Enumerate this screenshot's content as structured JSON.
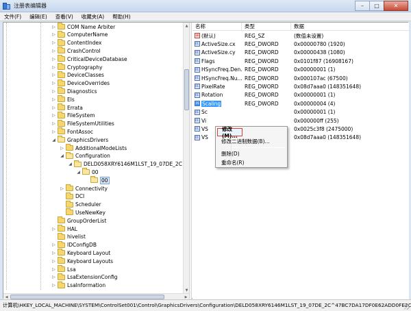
{
  "window": {
    "title": "注册表编辑器",
    "minimize": "–",
    "maximize": "□",
    "close": "✕"
  },
  "menu": [
    "文件(F)",
    "编辑(E)",
    "查看(V)",
    "收藏夹(A)",
    "帮助(H)"
  ],
  "tree": {
    "items": [
      {
        "label": "COM Name Arbiter",
        "toggle": "▷"
      },
      {
        "label": "ComputerName",
        "toggle": "▷"
      },
      {
        "label": "ContentIndex",
        "toggle": "▷"
      },
      {
        "label": "CrashControl",
        "toggle": "▷"
      },
      {
        "label": "CriticalDeviceDatabase",
        "toggle": "▷"
      },
      {
        "label": "Cryptography",
        "toggle": "▷"
      },
      {
        "label": "DeviceClasses",
        "toggle": "▷"
      },
      {
        "label": "DeviceOverrides",
        "toggle": "▷"
      },
      {
        "label": "Diagnostics",
        "toggle": "▷"
      },
      {
        "label": "Els",
        "toggle": "▷"
      },
      {
        "label": "Errata",
        "toggle": "▷"
      },
      {
        "label": "FileSystem",
        "toggle": "▷"
      },
      {
        "label": "FileSystemUtilities",
        "toggle": "▷"
      },
      {
        "label": "FontAssoc",
        "toggle": "▷"
      },
      {
        "label": "GraphicsDrivers",
        "toggle": "◢"
      },
      {
        "label": "AdditionalModeLists",
        "toggle": "▷"
      },
      {
        "label": "Configuration",
        "toggle": "◢"
      },
      {
        "label": "DELD058XRY6146M1LST_19_07DE_2C^47BC",
        "toggle": "◢"
      },
      {
        "label": "00",
        "toggle": "◢"
      },
      {
        "label": "00",
        "toggle": ""
      },
      {
        "label": "Connectivity",
        "toggle": "▷"
      },
      {
        "label": "DCI",
        "toggle": ""
      },
      {
        "label": "Scheduler",
        "toggle": ""
      },
      {
        "label": "UseNewKey",
        "toggle": ""
      },
      {
        "label": "GroupOrderList",
        "toggle": ""
      },
      {
        "label": "HAL",
        "toggle": "▷"
      },
      {
        "label": "hivelist",
        "toggle": ""
      },
      {
        "label": "IDConfigDB",
        "toggle": "▷"
      },
      {
        "label": "Keyboard Layout",
        "toggle": "▷"
      },
      {
        "label": "Keyboard Layouts",
        "toggle": "▷"
      },
      {
        "label": "Lsa",
        "toggle": "▷"
      },
      {
        "label": "LsaExtensionConfig",
        "toggle": "▷"
      },
      {
        "label": "LsaInformation",
        "toggle": "▷"
      }
    ]
  },
  "list": {
    "headers": {
      "name": "名称",
      "type": "类型",
      "data": "数据"
    },
    "rows": [
      {
        "name": "(默认)",
        "type": "REG_SZ",
        "data": "(数值未设置)",
        "icon": "ab"
      },
      {
        "name": "ActiveSize.cx",
        "type": "REG_DWORD",
        "data": "0x00000780 (1920)",
        "icon": "011"
      },
      {
        "name": "ActiveSize.cy",
        "type": "REG_DWORD",
        "data": "0x00000438 (1080)",
        "icon": "011"
      },
      {
        "name": "Flags",
        "type": "REG_DWORD",
        "data": "0x0101f87 (16908167)",
        "icon": "011"
      },
      {
        "name": "HSyncFreq.Den...",
        "type": "REG_DWORD",
        "data": "0x00000001 (1)",
        "icon": "011"
      },
      {
        "name": "HSyncFreq.Nu...",
        "type": "REG_DWORD",
        "data": "0x000107ac (67500)",
        "icon": "011"
      },
      {
        "name": "PixelRate",
        "type": "REG_DWORD",
        "data": "0x08d7aaa0 (148351648)",
        "icon": "011"
      },
      {
        "name": "Rotation",
        "type": "REG_DWORD",
        "data": "0x00000001 (1)",
        "icon": "011"
      },
      {
        "name": "Scaling",
        "type": "REG_DWORD",
        "data": "0x00000004 (4)",
        "icon": "011"
      },
      {
        "name": "Sc",
        "type": "",
        "data": "0x00000001 (1)",
        "icon": "011"
      },
      {
        "name": "Vi",
        "type": "",
        "data": "0x000000ff (255)",
        "icon": "011"
      },
      {
        "name": "VS",
        "type": "",
        "data": "0x0025c3f8 (2475000)",
        "icon": "011"
      },
      {
        "name": "VS",
        "type": "",
        "data": "0x08d7aaa0 (148351648)",
        "icon": "011"
      }
    ]
  },
  "context_menu": {
    "modify": "修改(M)...",
    "modify_binary": "修改二进制数据(B)...",
    "delete": "删除(D)",
    "rename": "重命名(R)"
  },
  "statusbar": "计算机\\HKEY_LOCAL_MACHINE\\SYSTEM\\ControlSet001\\Control\\GraphicsDrivers\\Configuration\\DELD058XRY6146M1LST_19_07DE_2C^47BC7DA17DF0E62ADD0FE2C074",
  "colors": {
    "highlight_border": "#e03b2e",
    "selection": "#3399ff",
    "folder": "#f5d76e"
  }
}
